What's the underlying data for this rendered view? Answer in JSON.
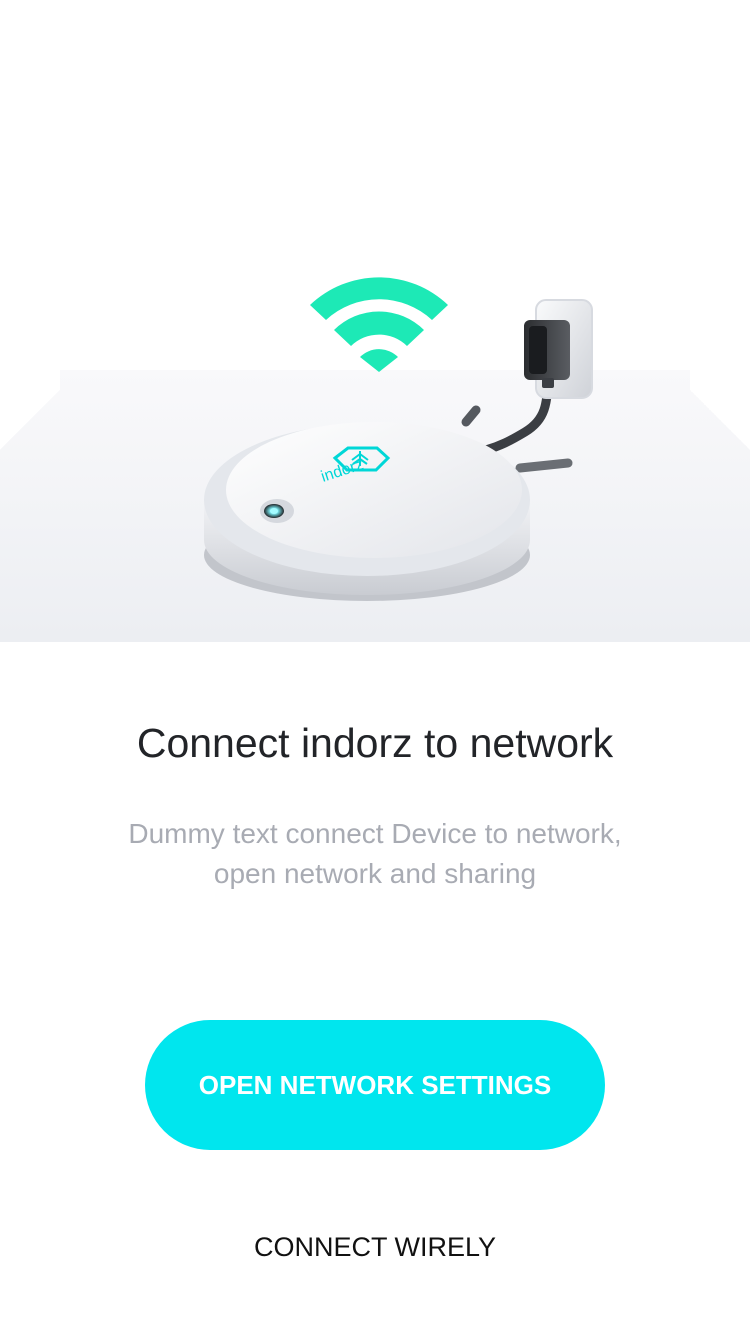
{
  "illustration": {
    "brand": "indorz",
    "icons": [
      "wifi-icon",
      "robot-device",
      "power-plug-icon"
    ],
    "colors": {
      "wifi": "#1de9b6",
      "accent": "#00e6ee",
      "device": "#e4e7ec"
    }
  },
  "content": {
    "title": "Connect indorz to network",
    "subtitle_line1": "Dummy text connect Device to network,",
    "subtitle_line2": "open network and sharing"
  },
  "actions": {
    "primary_label": "OPEN NETWORK SETTINGS",
    "secondary_label": "CONNECT WIRELY"
  }
}
